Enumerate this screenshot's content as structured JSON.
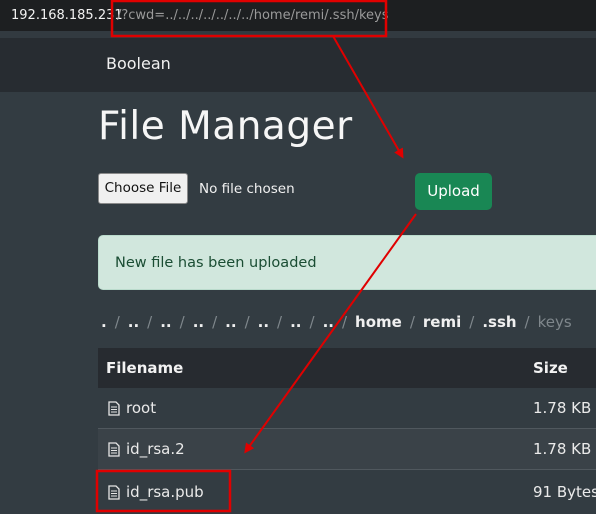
{
  "browser": {
    "url_host": "192.168.185.231",
    "url_path": "/?cwd=../../../../../../../home/remi/.ssh/keys"
  },
  "navbar": {
    "brand": "Boolean"
  },
  "page": {
    "title": "File Manager",
    "choose_file_label": "Choose File",
    "no_file_text": "No file chosen",
    "upload_label": "Upload",
    "alert_text": "New file has been uploaded"
  },
  "breadcrumb": [
    ".",
    "..",
    "..",
    "..",
    "..",
    "..",
    "..",
    "..",
    "home",
    "remi",
    ".ssh",
    "keys"
  ],
  "table": {
    "headers": {
      "filename": "Filename",
      "size": "Size"
    },
    "rows": [
      {
        "name": "root",
        "size": "1.78 KB"
      },
      {
        "name": "id_rsa.2",
        "size": "1.78 KB"
      },
      {
        "name": "id_rsa.pub",
        "size": "91 Bytes"
      }
    ]
  },
  "icons": {
    "file": "file-text-icon"
  },
  "colors": {
    "annotation": "#e00000",
    "upload": "#198754",
    "alert_bg": "#d1e7dd"
  }
}
